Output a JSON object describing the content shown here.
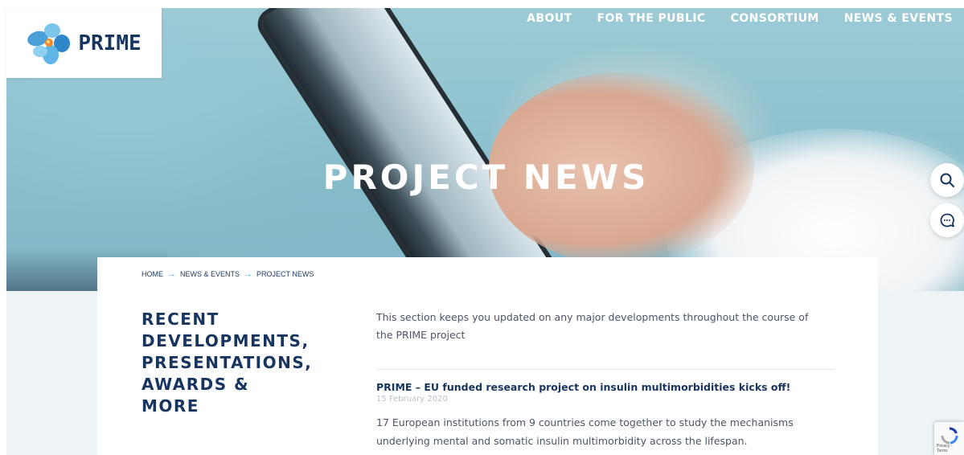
{
  "brand": {
    "name": "PRIME"
  },
  "nav": {
    "items": [
      "ABOUT",
      "FOR THE PUBLIC",
      "CONSORTIUM",
      "NEWS & EVENTS"
    ]
  },
  "hero": {
    "title": "PROJECT NEWS"
  },
  "breadcrumb": {
    "items": [
      "HOME",
      "NEWS & EVENTS",
      "PROJECT NEWS"
    ]
  },
  "sidebar": {
    "heading_lines": [
      "RECENT",
      "DEVELOPMENTS,",
      "PRESENTATIONS,",
      "AWARDS &",
      "MORE"
    ]
  },
  "main": {
    "intro": "This section keeps you updated on any major developments throughout the course of the PRIME project",
    "news": [
      {
        "title": "PRIME – EU funded research project on insulin multimorbidities kicks off!",
        "date": "15 February 2020",
        "excerpt": "17 European institutions from 9 countries come together to study the mechanisms underlying mental and somatic insulin multimorbidity across the lifespan."
      }
    ]
  },
  "floating": {
    "icons": [
      "search-icon",
      "chat-icon"
    ]
  },
  "recaptcha": {
    "label": "Privacy - Terms"
  },
  "colors": {
    "navy": "#17355f",
    "accent": "#2bb6e6",
    "text": "#4a5566",
    "date": "#b9c3cd"
  }
}
